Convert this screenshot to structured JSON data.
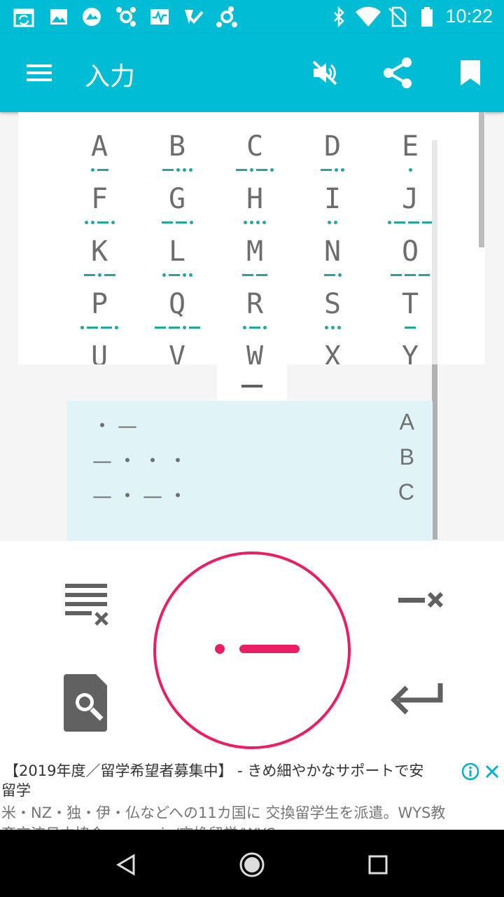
{
  "status_bar": {
    "time": "10:22",
    "left_icons": [
      "calendar-sync-icon",
      "image-icon",
      "globe-icon",
      "app-icon",
      "activity-icon",
      "check-icon",
      "app-icon-2"
    ],
    "right_icons": [
      "bluetooth-icon",
      "wifi-icon",
      "no-sim-icon",
      "battery-icon"
    ]
  },
  "app_bar": {
    "title": "入力",
    "menu_icon": "menu-icon",
    "mute_icon": "volume-off-icon",
    "share_icon": "share-icon",
    "bookmark_icon": "bookmark-icon",
    "color": "#00bcd4"
  },
  "morse_grid": [
    {
      "ch": "A",
      "code": ".-"
    },
    {
      "ch": "B",
      "code": "-..."
    },
    {
      "ch": "C",
      "code": "-.-."
    },
    {
      "ch": "D",
      "code": "-.."
    },
    {
      "ch": "E",
      "code": "."
    },
    {
      "ch": "F",
      "code": "..-."
    },
    {
      "ch": "G",
      "code": "--."
    },
    {
      "ch": "H",
      "code": "...."
    },
    {
      "ch": "I",
      "code": ".."
    },
    {
      "ch": "J",
      "code": ".---"
    },
    {
      "ch": "K",
      "code": "-.-"
    },
    {
      "ch": "L",
      "code": ".-.."
    },
    {
      "ch": "M",
      "code": "--"
    },
    {
      "ch": "N",
      "code": "-."
    },
    {
      "ch": "O",
      "code": "---"
    },
    {
      "ch": "P",
      "code": ".--."
    },
    {
      "ch": "Q",
      "code": "--.-"
    },
    {
      "ch": "R",
      "code": ".-."
    },
    {
      "ch": "S",
      "code": "..."
    },
    {
      "ch": "T",
      "code": "-"
    },
    {
      "ch": "U",
      "code": "..-"
    },
    {
      "ch": "V",
      "code": "...-"
    },
    {
      "ch": "W",
      "code": ".--"
    },
    {
      "ch": "X",
      "code": "-..-"
    },
    {
      "ch": "Y",
      "code": "-.--"
    }
  ],
  "input_rows": [
    {
      "seq": "・—",
      "letter": "A"
    },
    {
      "seq": "—・・・",
      "letter": "B"
    },
    {
      "seq": "—・—・",
      "letter": "C"
    }
  ],
  "keyboard": {
    "current_input": ".-",
    "accent": "#e91e63",
    "clear_all_icon": "clear-all-icon",
    "search_doc_icon": "search-document-icon",
    "backspace_icon": "dash-delete-icon",
    "enter_icon": "enter-icon"
  },
  "ad": {
    "line1": "【2019年度／留学希望者募集中】 - きめ細やかなサポートで安",
    "line2": "留学",
    "line3": "米・NZ・独・伊・仏などへの11カ国に 交換留学生を派遣。WYS教",
    "line4": "育交流日本協会 wys.gr.jp/交換留学/WYS"
  },
  "nav_bar": {
    "back_icon": "back-icon",
    "home_icon": "home-icon",
    "recents_icon": "recents-icon"
  }
}
